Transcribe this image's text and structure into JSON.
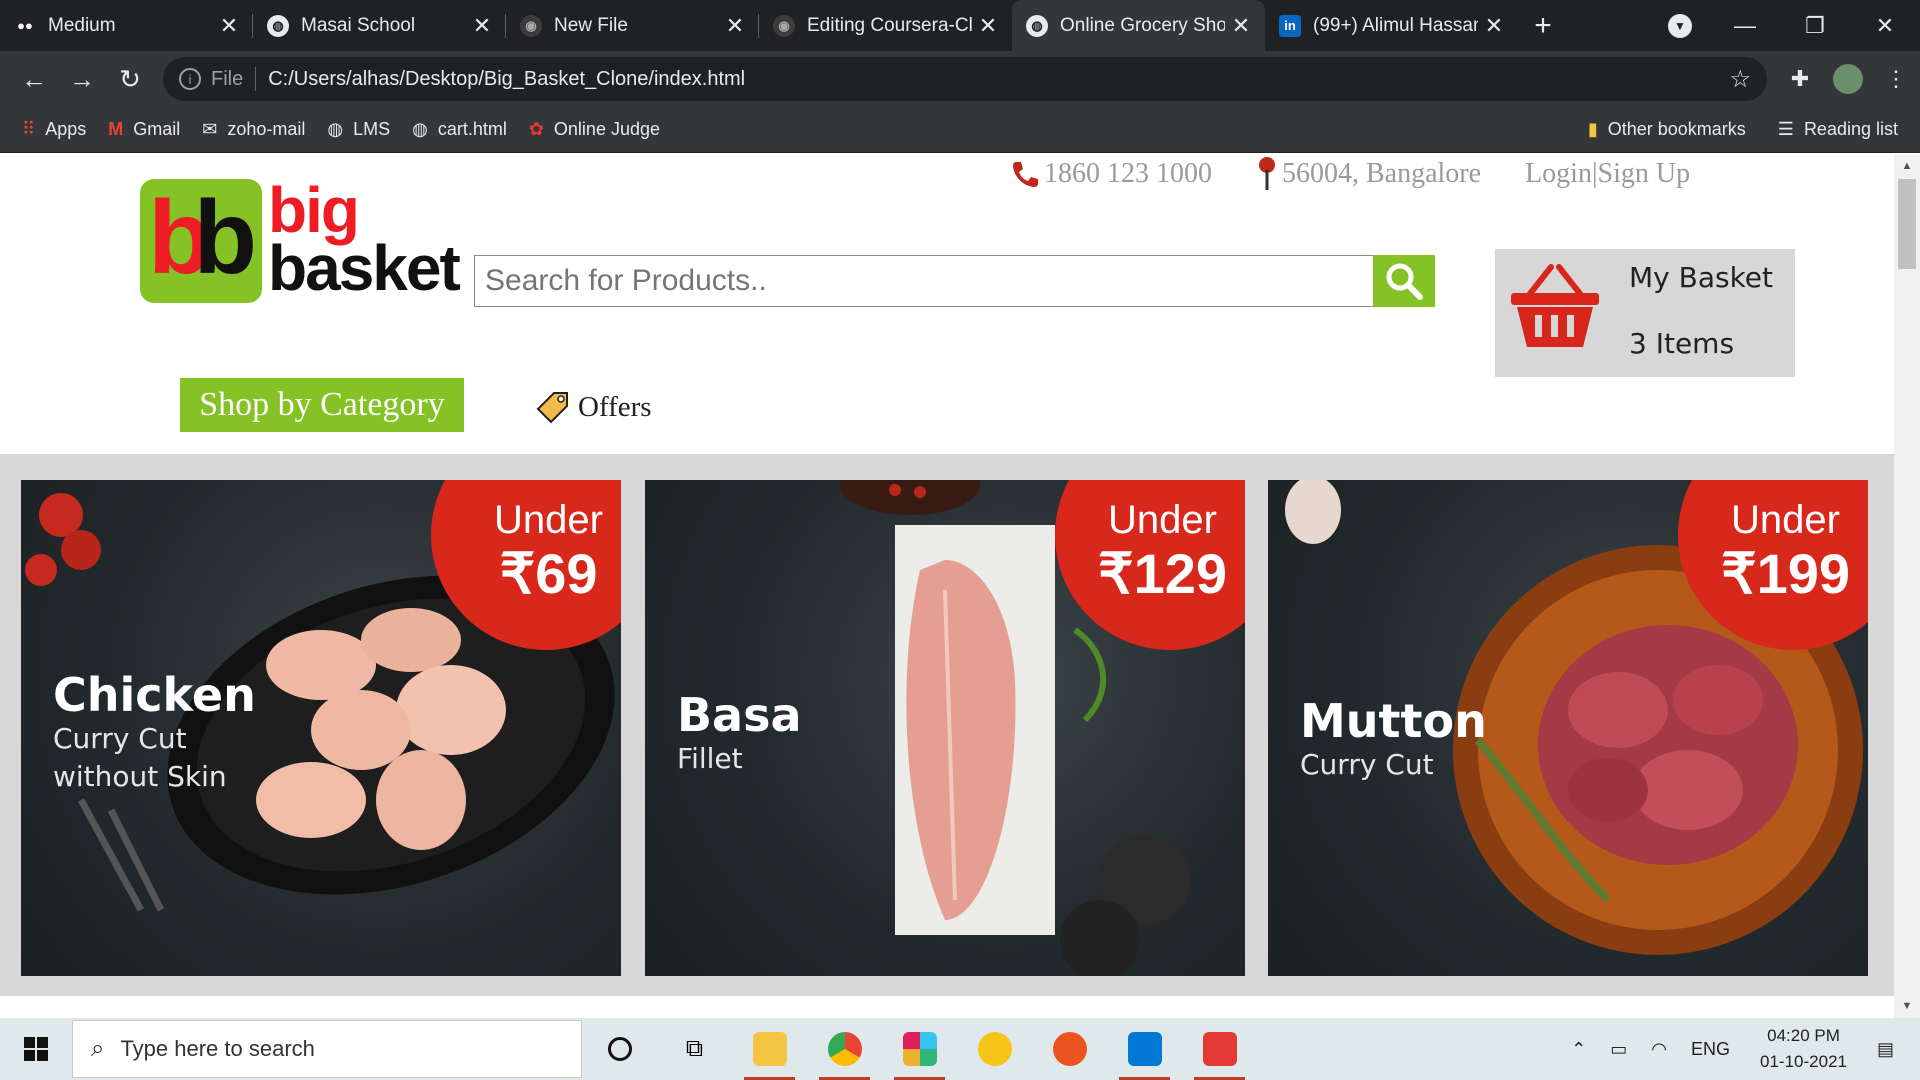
{
  "browser": {
    "tabs": [
      {
        "title": "Medium",
        "icon": "medium-icon",
        "active": false
      },
      {
        "title": "Masai School",
        "icon": "globe-icon",
        "active": false
      },
      {
        "title": "New File",
        "icon": "github-icon",
        "active": false
      },
      {
        "title": "Editing Coursera-Cl",
        "icon": "github-icon",
        "active": false
      },
      {
        "title": "Online Grocery Sho",
        "icon": "globe-icon",
        "active": true
      },
      {
        "title": "(99+) Alimul Hassan",
        "icon": "linkedin-icon",
        "active": false
      }
    ],
    "address": {
      "scheme": "File",
      "url": "C:/Users/alhas/Desktop/Big_Basket_Clone/index.html"
    },
    "bookmarks": [
      {
        "label": "Apps",
        "icon": "apps-grid-icon"
      },
      {
        "label": "Gmail",
        "icon": "gmail-icon"
      },
      {
        "label": "zoho-mail",
        "icon": "zoho-icon"
      },
      {
        "label": "LMS",
        "icon": "globe-icon"
      },
      {
        "label": "cart.html",
        "icon": "globe-icon"
      },
      {
        "label": "Online Judge",
        "icon": "judge-icon"
      }
    ],
    "bookmarks_right": [
      {
        "label": "Other bookmarks",
        "icon": "folder-icon"
      },
      {
        "label": "Reading list",
        "icon": "reading-list-icon"
      }
    ]
  },
  "site": {
    "phone": "1860 123 1000",
    "location": "56004, Bangalore",
    "auth": "Login|Sign Up",
    "logo_big": "big",
    "logo_basket": "basket",
    "search_placeholder": "Search for Products..",
    "basket_title": "My Basket",
    "basket_count": "3 Items",
    "shop_by_category": "Shop by Category",
    "offers": "Offers",
    "colors": {
      "brand_green": "#84c225",
      "brand_red": "#ee1c25",
      "badge_red": "#d8281c"
    }
  },
  "banners": [
    {
      "under": "Under",
      "price": "₹69",
      "name": "Chicken",
      "sub1": "Curry Cut",
      "sub2": "without Skin"
    },
    {
      "under": "Under",
      "price": "₹129",
      "name": "Basa",
      "sub1": "Fillet",
      "sub2": ""
    },
    {
      "under": "Under",
      "price": "₹199",
      "name": "Mutton",
      "sub1": "Curry Cut",
      "sub2": ""
    }
  ],
  "taskbar": {
    "search_placeholder": "Type here to search",
    "apps": [
      "cortana-icon",
      "task-view-icon",
      "file-explorer-icon",
      "chrome-icon",
      "slack-icon",
      "todo-icon",
      "ubuntu-icon",
      "vscode-icon",
      "whatsapp-icon"
    ],
    "language": "ENG",
    "time": "04:20 PM",
    "date": "01-10-2021"
  }
}
